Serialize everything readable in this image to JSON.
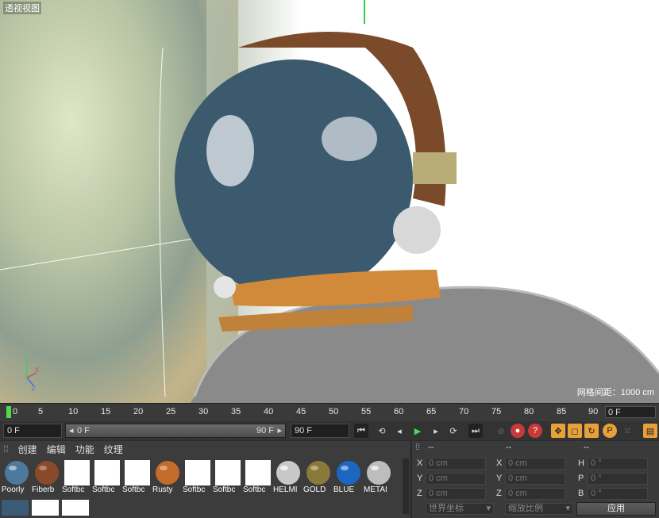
{
  "viewport": {
    "title": "透视视图",
    "grid_readout": "网格间距：1000 cm"
  },
  "timeline": {
    "ticks": [
      "0",
      "5",
      "10",
      "15",
      "20",
      "25",
      "30",
      "35",
      "40",
      "45",
      "50",
      "55",
      "60",
      "65",
      "70",
      "75",
      "80",
      "85",
      "90"
    ],
    "end_field": "0 F"
  },
  "controls": {
    "start_frame": "0 F",
    "slider_left": "0 F",
    "slider_right": "90 F",
    "end_frame": "90 F"
  },
  "material_menu": [
    "创建",
    "编辑",
    "功能",
    "纹理"
  ],
  "materials": [
    {
      "label": "Poorly",
      "color": "#4d7a9c"
    },
    {
      "label": "Fiberb",
      "color": "#8a4a2a"
    },
    {
      "label": "Softbc",
      "color": "#ffffff"
    },
    {
      "label": "Softbc",
      "color": "#ffffff"
    },
    {
      "label": "Softbc",
      "color": "#ffffff"
    },
    {
      "label": "Rusty",
      "color": "#c46a2a"
    },
    {
      "label": "Softbc",
      "color": "#ffffff"
    },
    {
      "label": "Softbc",
      "color": "#ffffff"
    },
    {
      "label": "Softbc",
      "color": "#ffffff"
    },
    {
      "label": "HELMI",
      "color": "#c8c8c8"
    },
    {
      "label": "GOLD",
      "color": "#8a7a3a"
    },
    {
      "label": "BLUE",
      "color": "#1b66c0"
    },
    {
      "label": "METAI",
      "color": "#bdbdbd"
    }
  ],
  "coords": {
    "header_a": "--",
    "header_b": "--",
    "header_c": "--",
    "rows": [
      {
        "l1": "X",
        "v1": "0 cm",
        "l2": "X",
        "v2": "0 cm",
        "l3": "H",
        "v3": "0 °"
      },
      {
        "l1": "Y",
        "v1": "0 cm",
        "l2": "Y",
        "v2": "0 cm",
        "l3": "P",
        "v3": "0 °"
      },
      {
        "l1": "Z",
        "v1": "0 cm",
        "l2": "Z",
        "v2": "0 cm",
        "l3": "B",
        "v3": "0 °"
      }
    ],
    "dropdown_world": "世界坐标",
    "dropdown_scale": "缩放比例",
    "apply": "应用"
  }
}
